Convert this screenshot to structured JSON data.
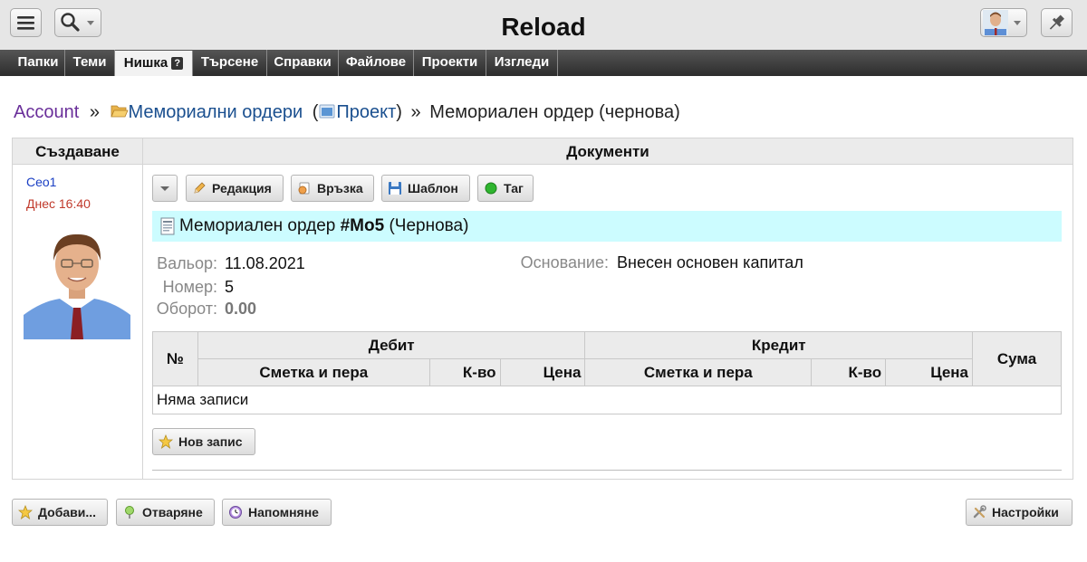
{
  "app": {
    "title": "Reload"
  },
  "nav_tabs": [
    {
      "label": "Папки"
    },
    {
      "label": "Теми"
    },
    {
      "label": "Нишка",
      "active": true,
      "help_icon": "?"
    },
    {
      "label": "Търсене"
    },
    {
      "label": "Справки"
    },
    {
      "label": "Файлове"
    },
    {
      "label": "Проекти"
    },
    {
      "label": "Изгледи"
    }
  ],
  "breadcrumb": {
    "account": "Account",
    "sep1": "»",
    "folder": "Мемориални ордери",
    "paren_open": "(",
    "project": "Проект",
    "paren_close": ")",
    "sep2": "»",
    "current": "Мемориален ордер (чернова)"
  },
  "columns": {
    "left": "Създаване",
    "right": "Документи"
  },
  "creator": {
    "name": "Ceo1",
    "time": "Днес 16:40"
  },
  "doc_toolbar": {
    "edit": "Редакция",
    "link": "Връзка",
    "template": "Шаблон",
    "tag": "Таг"
  },
  "document": {
    "title_prefix": "Мемориален ордер",
    "number": "#Mo5",
    "status": "(Чернова)",
    "fields": {
      "valor_label": "Вальор:",
      "valor_value": "11.08.2021",
      "number_label": "Номер:",
      "number_value": "5",
      "turnover_label": "Оборот:",
      "turnover_value": "0.00",
      "basis_label": "Основание:",
      "basis_value": "Внесен основен капитал"
    }
  },
  "entries_table": {
    "no_header": "№",
    "debit_header": "Дебит",
    "credit_header": "Кредит",
    "sum_header": "Сума",
    "account_col": "Сметка и пера",
    "qty_col": "К-во",
    "price_col": "Цена",
    "empty_message": "Няма записи"
  },
  "new_entry_button": "Нов запис",
  "footer": {
    "add": "Добави...",
    "open": "Отваряне",
    "reminder": "Напомняне",
    "settings": "Настройки"
  },
  "colors": {
    "accent_bar": "#ccfcff",
    "creator_name": "#1a3fc4",
    "creator_time": "#c0392b",
    "account_link": "#6a2f9a",
    "link": "#1a4f8f"
  }
}
